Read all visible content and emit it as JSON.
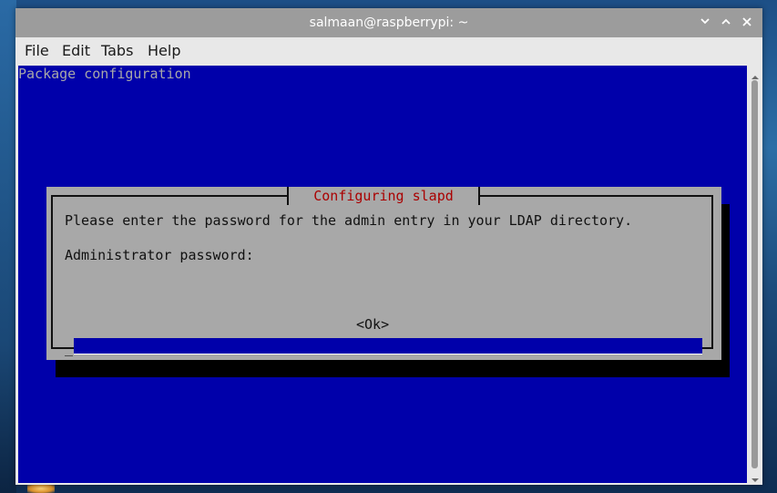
{
  "window": {
    "title": "salmaan@raspberrypi: ~",
    "controls": [
      "minimize-icon",
      "maximize-icon",
      "close-icon"
    ]
  },
  "menubar": {
    "items": [
      "File",
      "Edit",
      "Tabs",
      "Help"
    ]
  },
  "terminal": {
    "background": "#0000aa",
    "header": "Package configuration",
    "dialog": {
      "title": "Configuring slapd",
      "prompt": "Please enter the password for the admin entry in your LDAP directory.",
      "field_label": "Administrator password:",
      "password_value": "",
      "cursor": "_",
      "ok_label": "<Ok>"
    }
  },
  "colors": {
    "terminal_bg": "#0000aa",
    "dialog_bg": "#a8a8a8",
    "dialog_title": "#aa0000",
    "titlebar": "#9c9c9c"
  }
}
